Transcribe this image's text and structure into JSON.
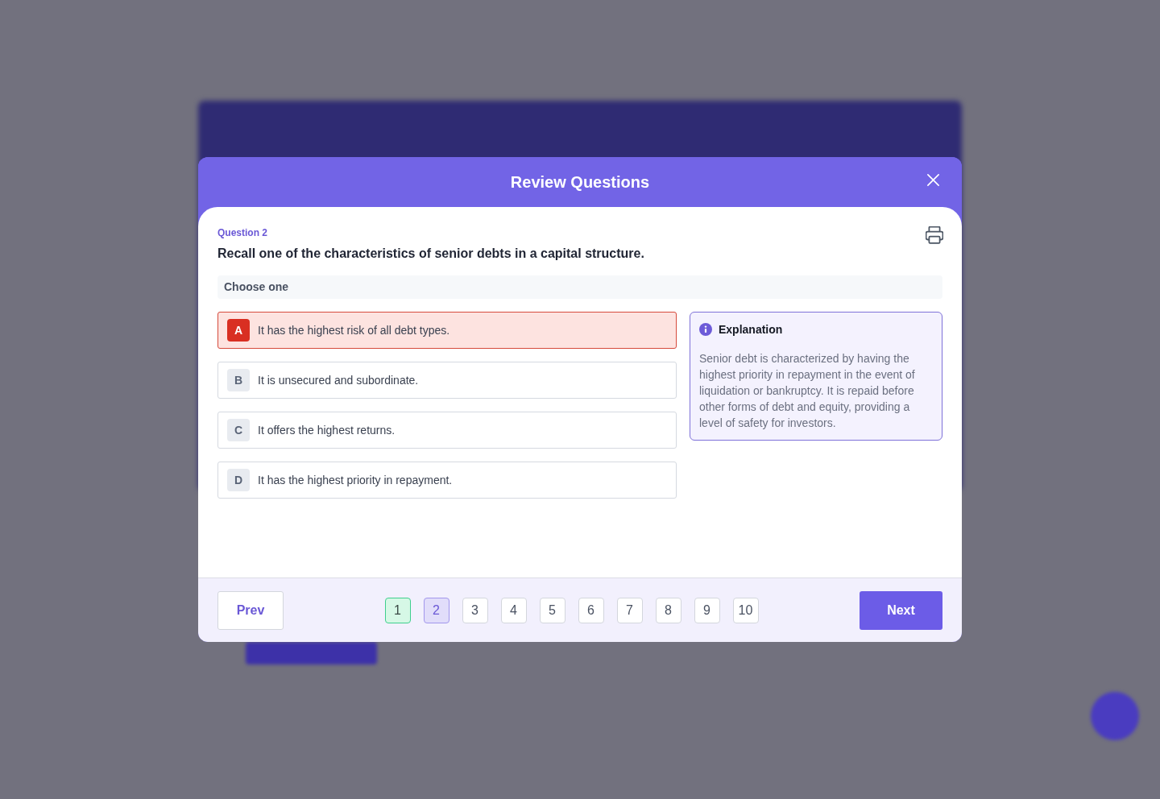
{
  "dialog": {
    "title": "Review Questions"
  },
  "question": {
    "number_label": "Question 2",
    "text": "Recall one of the characteristics of senior debts in a capital structure.",
    "instruction": "Choose one"
  },
  "options": [
    {
      "letter": "A",
      "text": "It has the highest risk of all debt types.",
      "selected": true
    },
    {
      "letter": "B",
      "text": "It is unsecured and subordinate.",
      "selected": false
    },
    {
      "letter": "C",
      "text": "It offers the highest returns.",
      "selected": false
    },
    {
      "letter": "D",
      "text": "It has the highest priority in repayment.",
      "selected": false
    }
  ],
  "explanation": {
    "title": "Explanation",
    "text": "Senior debt is characterized by having the highest priority in repayment in the event of liquidation or bankruptcy. It is repaid before other forms of debt and equity, providing a level of safety for investors."
  },
  "pagination": {
    "prev": "Prev",
    "pages": [
      {
        "label": "1",
        "selected": false,
        "correct": true
      },
      {
        "label": "2",
        "selected": true,
        "correct": false
      },
      {
        "label": "3",
        "selected": false,
        "correct": false
      },
      {
        "label": "4",
        "selected": false,
        "correct": false
      },
      {
        "label": "5",
        "selected": false,
        "correct": false
      },
      {
        "label": "6",
        "selected": false,
        "correct": false
      },
      {
        "label": "7",
        "selected": false,
        "correct": false
      },
      {
        "label": "8",
        "selected": false,
        "correct": false
      },
      {
        "label": "9",
        "selected": false,
        "correct": false
      },
      {
        "label": "10",
        "selected": false,
        "correct": false
      }
    ],
    "next": "Next"
  }
}
